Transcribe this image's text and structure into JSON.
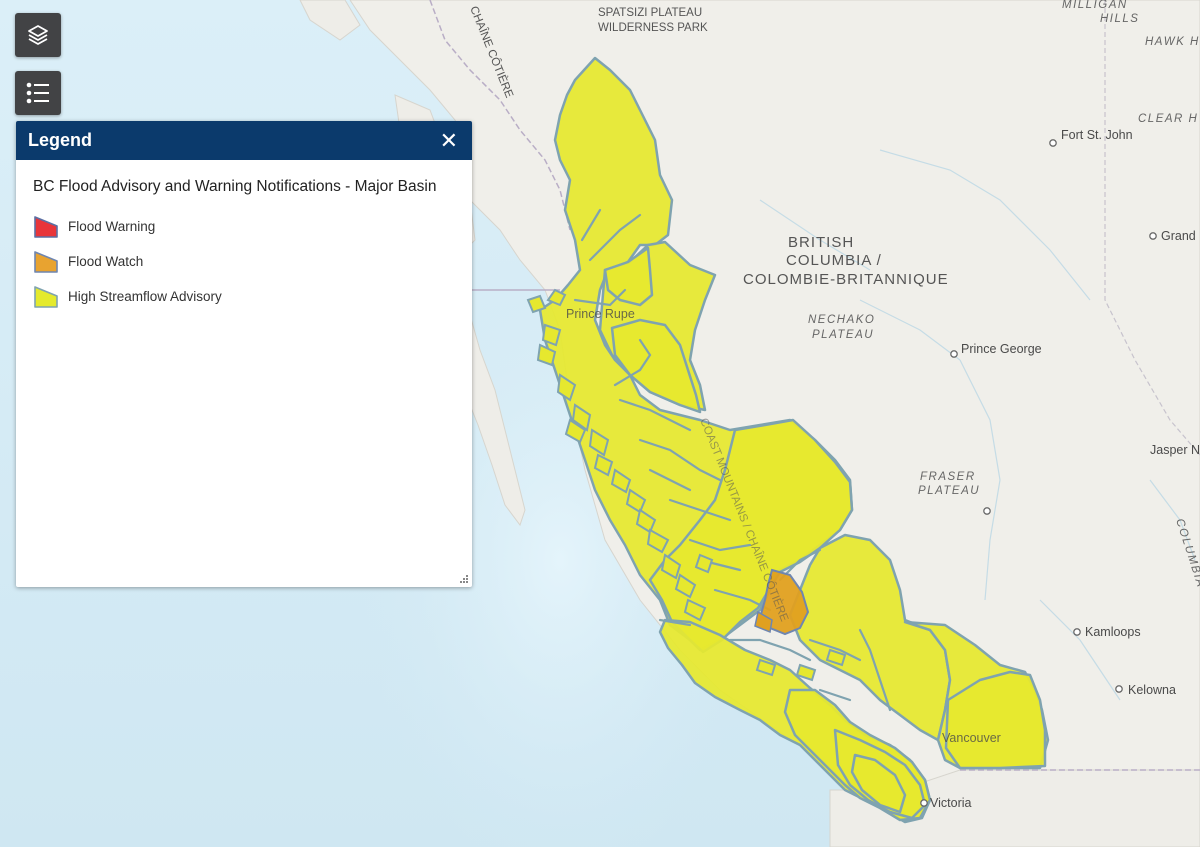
{
  "legend": {
    "title": "Legend",
    "close_symbol": "✕",
    "layer_title": "BC Flood Advisory and Warning Notifications - Major Basin",
    "items": [
      {
        "label": "Flood Warning",
        "fill_color": "#e8353a",
        "border_color": "#5b6fa3"
      },
      {
        "label": "Flood Watch",
        "fill_color": "#e8a330",
        "border_color": "#6f86b0"
      },
      {
        "label": "High Streamflow Advisory",
        "fill_color": "#e4ea2d",
        "border_color": "#7fa3b0"
      }
    ]
  },
  "toolbar": {
    "layers_icon": "layers-icon",
    "legend_icon": "legend-list-icon"
  },
  "map": {
    "ocean_color": "#d5ebf5",
    "land_color": "#f0f0ec",
    "labels": {
      "spatsizi1": "SPATSIZI PLATEAU",
      "spatsizi2": "WILDERNESS PARK",
      "milligan1": "MILLIGAN",
      "milligan2": "HILLS",
      "hawk": "HAWK H",
      "clear": "CLEAR H",
      "chaine": "CHAÎNE CÔTIÈRE",
      "fort_st_john": "Fort St. John",
      "grand": "Grand",
      "bc1": "BRITISH",
      "bc2": "COLUMBIA /",
      "bc3": "COLOMBIE-BRITANNIQUE",
      "nechako1": "NECHAKO",
      "nechako2": "PLATEAU",
      "prince_george": "Prince George",
      "prince_rupert": "Prince Rupe",
      "jasper": "Jasper Na",
      "fraser1": "FRASER",
      "fraser2": "PLATEAU",
      "columbia": "COLUMBIA",
      "kamloops": "Kamloops",
      "kelowna": "Kelowna",
      "vancouver": "Vancouver",
      "victoria": "Victoria",
      "coast_mtn": "COAST MOUNTAINS / CHAÎNE CÔTIÈRE"
    }
  }
}
